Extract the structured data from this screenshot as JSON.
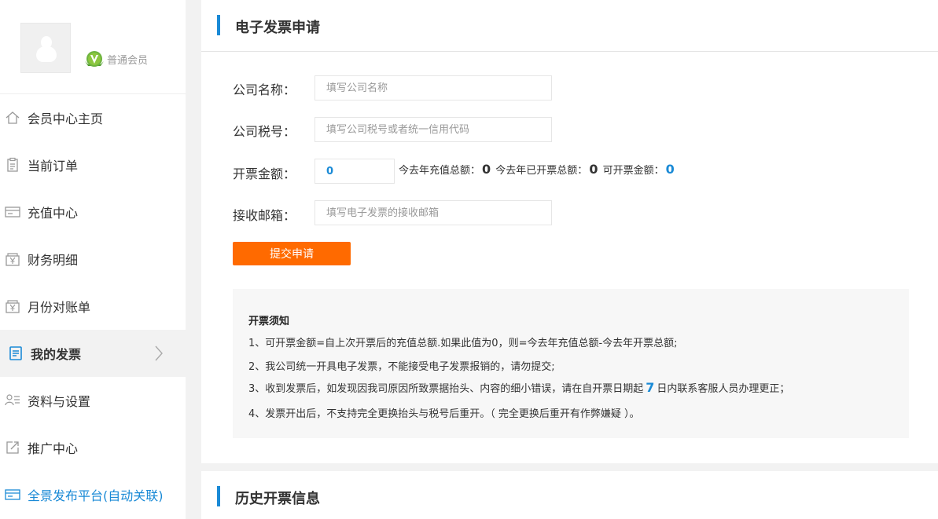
{
  "sidebar": {
    "member_level": "普通会员",
    "items": [
      {
        "label": "会员中心主页",
        "icon": "home-icon"
      },
      {
        "label": "当前订单",
        "icon": "clipboard-icon"
      },
      {
        "label": "充值中心",
        "icon": "card-icon"
      },
      {
        "label": "财务明细",
        "icon": "yen-box-icon"
      },
      {
        "label": "月份对账单",
        "icon": "yen-box-icon"
      },
      {
        "label": "我的发票",
        "icon": "document-icon",
        "active": true
      },
      {
        "label": "资料与设置",
        "icon": "user-list-icon"
      },
      {
        "label": "推广中心",
        "icon": "share-icon"
      },
      {
        "label": "全景发布平台(自动关联)",
        "icon": "card-icon"
      }
    ]
  },
  "invoice_form": {
    "title": "电子发票申请",
    "company_name_label": "公司名称：",
    "company_name_placeholder": "填写公司名称",
    "tax_id_label": "公司税号：",
    "tax_id_placeholder": "填写公司税号或者统一信用代码",
    "amount_label": "开票金额：",
    "amount_value": "0",
    "recharge_total_label": "今去年充值总额：",
    "recharge_total_value": "0",
    "invoiced_total_label": "今去年已开票总额：",
    "invoiced_total_value": "0",
    "available_label": "可开票金额：",
    "available_value": "0",
    "email_label": "接收邮箱：",
    "email_placeholder": "填写电子发票的接收邮箱",
    "submit_label": "提交申请"
  },
  "notice": {
    "title": "开票须知",
    "line1": "1、可开票金额=自上次开票后的充值总额.如果此值为0，则=今去年充值总额-今去年开票总额;",
    "line2": "2、我公司统一开具电子发票，不能接受电子发票报销的，请勿提交;",
    "line3_before": "3、收到发票后，如发现因我司原因所致票据抬头、内容的细小错误，请在自开票日期起",
    "line3_days": "7",
    "line3_after": "日内联系客服人员办理更正；",
    "line4": "4、发票开出后，不支持完全更换抬头与税号后重开。（ 完全更换后重开有作弊嫌疑 ）。"
  },
  "history": {
    "title": "历史开票信息"
  },
  "colors": {
    "accent": "#1a8ad6",
    "submit": "#ff6a00",
    "badge": "#6db33f"
  }
}
